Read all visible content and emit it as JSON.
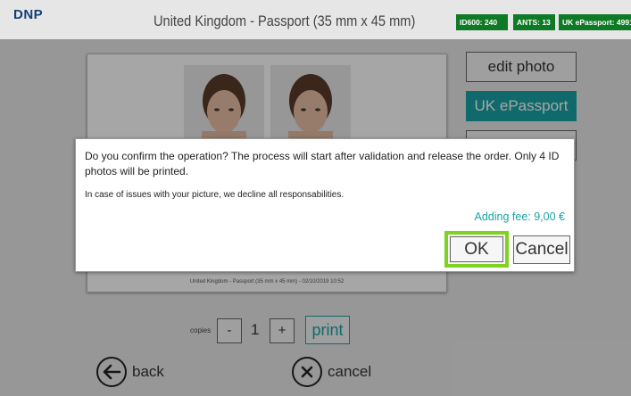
{
  "header": {
    "logo": "DNP",
    "title": "United Kingdom - Passport (35 mm x 45 mm)",
    "badges": [
      "ID600: 240",
      "ANTS: 13",
      "UK ePassport: 4991"
    ]
  },
  "preview": {
    "caption": "United Kingdom - Passport (35 mm x 45 mm) - 02/10/2019 10:52"
  },
  "side_buttons": {
    "edit_photo": "edit photo",
    "uk_epassport": "UK ePassport"
  },
  "dialog": {
    "message": "Do you confirm the operation? The process will start after validation and release the order. Only 4 ID photos will be printed.",
    "note": "In case of issues with your picture, we decline all responsabilities.",
    "fee": "Adding fee: 9,00 €",
    "ok_label": "OK",
    "cancel_label": "Cancel"
  },
  "controls": {
    "copies_label": "copies",
    "minus": "-",
    "quantity": "1",
    "plus": "+",
    "print_label": "print"
  },
  "nav": {
    "back_label": "back",
    "cancel_label": "cancel"
  },
  "colors": {
    "accent": "#1aa3a6",
    "ok_highlight": "#7ed321",
    "badge_green": "#0f7a26",
    "logo_blue": "#123f78"
  }
}
